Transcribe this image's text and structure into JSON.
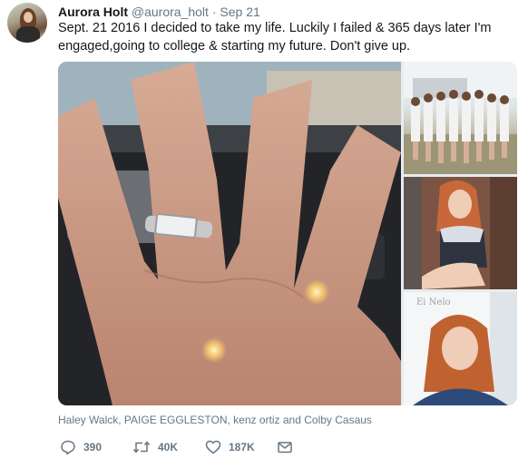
{
  "tweet": {
    "author_name": "Aurora Holt",
    "author_handle": "@aurora_holt",
    "separator": "·",
    "timestamp": "Sep 21",
    "text": "Sept. 21 2016 I decided to take my life. Luckily I failed & 365 days later I'm engaged,going to college & starting my future. Don't give up."
  },
  "media": {
    "tagged": [
      "Haley Walck",
      "PAIGE EGGLESTON",
      "kenz ortiz",
      "Colby Casaus"
    ],
    "tag_sep_1": ", ",
    "tag_sep_2": ", ",
    "tag_and": " and "
  },
  "actions": {
    "replies": "390",
    "retweets": "40K",
    "likes": "187K"
  },
  "icons": {
    "reply": "reply-icon",
    "retweet": "retweet-icon",
    "like": "heart-icon",
    "dm": "envelope-icon"
  },
  "colors": {
    "text": "#14171a",
    "secondary": "#657786"
  }
}
